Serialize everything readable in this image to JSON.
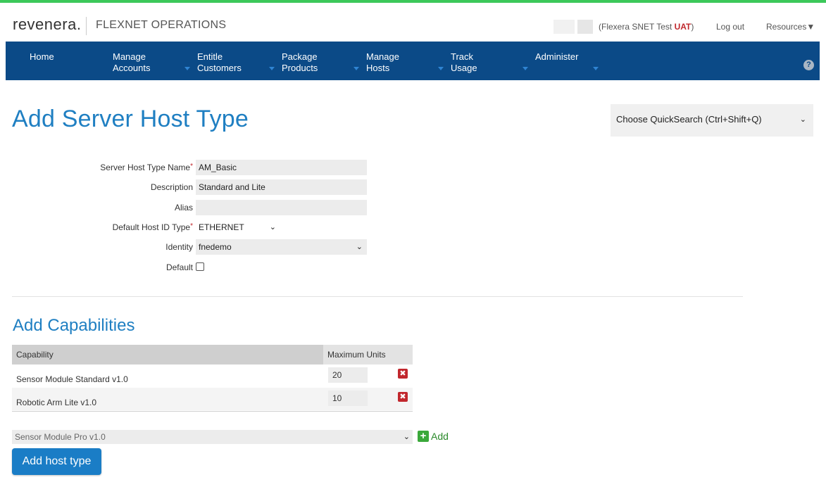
{
  "colors": {
    "accent_green": "#3cc85a",
    "nav_bg": "#0b4a87",
    "title_blue": "#1f7fc2",
    "danger_red": "#c1272d",
    "add_green": "#3aa83a"
  },
  "header": {
    "logo": "revenera.",
    "product": "FLEXNET OPERATIONS",
    "tenant_prefix": "(Flexera SNET Test ",
    "tenant_env": "UAT",
    "tenant_suffix": ")",
    "logout": "Log out",
    "resources": "Resources▼"
  },
  "nav": {
    "items": [
      {
        "label": "Home",
        "has_dropdown": false
      },
      {
        "label": "Manage\nAccounts",
        "has_dropdown": true
      },
      {
        "label": "Entitle\nCustomers",
        "has_dropdown": true
      },
      {
        "label": "Package\nProducts",
        "has_dropdown": true
      },
      {
        "label": "Manage\nHosts",
        "has_dropdown": true
      },
      {
        "label": "Track\nUsage",
        "has_dropdown": true
      },
      {
        "label": "Administer",
        "has_dropdown": true
      }
    ],
    "help_icon": "help-icon",
    "help_glyph": "?"
  },
  "page": {
    "title": "Add Server Host Type"
  },
  "quicksearch": {
    "selected": "Choose QuickSearch (Ctrl+Shift+Q)"
  },
  "form": {
    "name_label": "Server Host Type Name",
    "name_value": "AM_Basic",
    "description_label": "Description",
    "description_value": "Standard and Lite",
    "alias_label": "Alias",
    "alias_value": "",
    "hostid_label": "Default Host ID Type",
    "hostid_value": "ETHERNET",
    "identity_label": "Identity",
    "identity_value": "fnedemo",
    "default_label": "Default",
    "default_checked": false,
    "required_marker": "*"
  },
  "capabilities": {
    "section_title": "Add Capabilities",
    "col_capability": "Capability",
    "col_max_units": "Maximum Units",
    "rows": [
      {
        "name": "Sensor Module Standard v1.0",
        "units": "20"
      },
      {
        "name": "Robotic Arm Lite v1.0",
        "units": "10"
      }
    ],
    "delete_glyph": "✖",
    "new_selected": "Sensor Module Pro v1.0",
    "add_glyph": "+",
    "add_label": "Add"
  },
  "actions": {
    "submit_label": "Add host type"
  }
}
